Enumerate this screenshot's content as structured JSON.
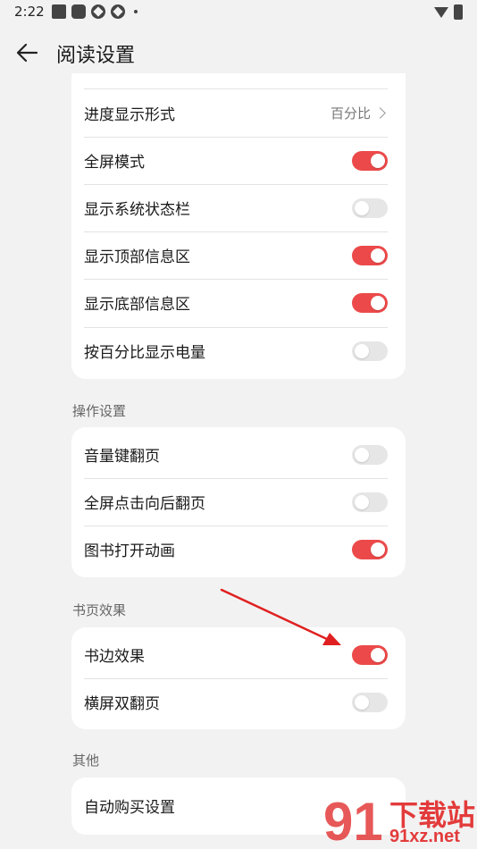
{
  "status_bar": {
    "time": "2:22"
  },
  "header": {
    "title": "阅读设置"
  },
  "display_section": {
    "items": [
      {
        "label": "进度显示形式",
        "value": "百分比"
      },
      {
        "label": "全屏模式",
        "toggle": "on"
      },
      {
        "label": "显示系统状态栏",
        "toggle": "off"
      },
      {
        "label": "显示顶部信息区",
        "toggle": "on"
      },
      {
        "label": "显示底部信息区",
        "toggle": "on"
      },
      {
        "label": "按百分比显示电量",
        "toggle": "off"
      }
    ]
  },
  "operation_section": {
    "title": "操作设置",
    "items": [
      {
        "label": "音量键翻页",
        "toggle": "off"
      },
      {
        "label": "全屏点击向后翻页",
        "toggle": "off"
      },
      {
        "label": "图书打开动画",
        "toggle": "on"
      }
    ]
  },
  "page_effect_section": {
    "title": "书页效果",
    "items": [
      {
        "label": "书边效果",
        "toggle": "on"
      },
      {
        "label": "横屏双翻页",
        "toggle": "off"
      }
    ]
  },
  "other_section": {
    "title": "其他",
    "items": [
      {
        "label": "自动购买设置"
      }
    ]
  },
  "watermark": {
    "brand": "下载站",
    "domain": "91xz.net"
  },
  "colors": {
    "accent": "#ec4a4a",
    "background": "#f2f2f2",
    "card": "#ffffff"
  }
}
